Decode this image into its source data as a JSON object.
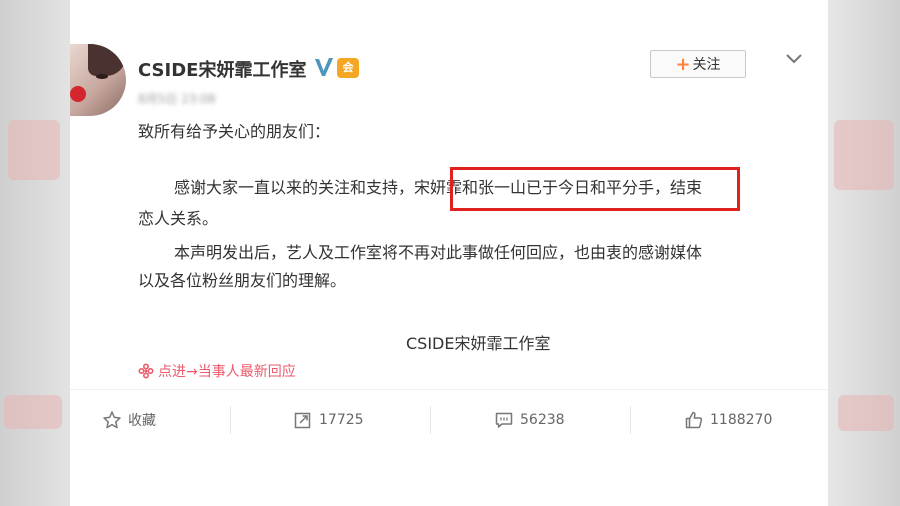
{
  "account": {
    "name": "CSIDE宋妍霏工作室",
    "vip_label": "会",
    "follow_label": "关注",
    "follow_plus": "+",
    "time_blurred": "8月5日 23:08"
  },
  "post": {
    "greeting": "致所有给予关心的朋友们：",
    "p1_before": "感谢大家一直以来的关注和支持，",
    "p1_highlight": "宋妍霏和张一山已于今日和平分手",
    "p1_after": "，结束",
    "p1_line2": "恋人关系。",
    "p2_line1": "本声明发出后，艺人及工作室将不再对此事做任何回应，也由衷的感谢媒体",
    "p2_line2": "以及各位粉丝朋友们的理解。",
    "signature": "CSIDE宋妍霏工作室",
    "link_text": "点进→当事人最新回应"
  },
  "actions": {
    "favorite_label": "收藏",
    "repost_count": "17725",
    "comment_count": "56238",
    "like_count": "1188270"
  },
  "colors": {
    "accent_orange": "#ff8140",
    "highlight_red": "#e0211f",
    "link_pink": "#eb5b6b",
    "verified_yellow": "#f5b800"
  }
}
